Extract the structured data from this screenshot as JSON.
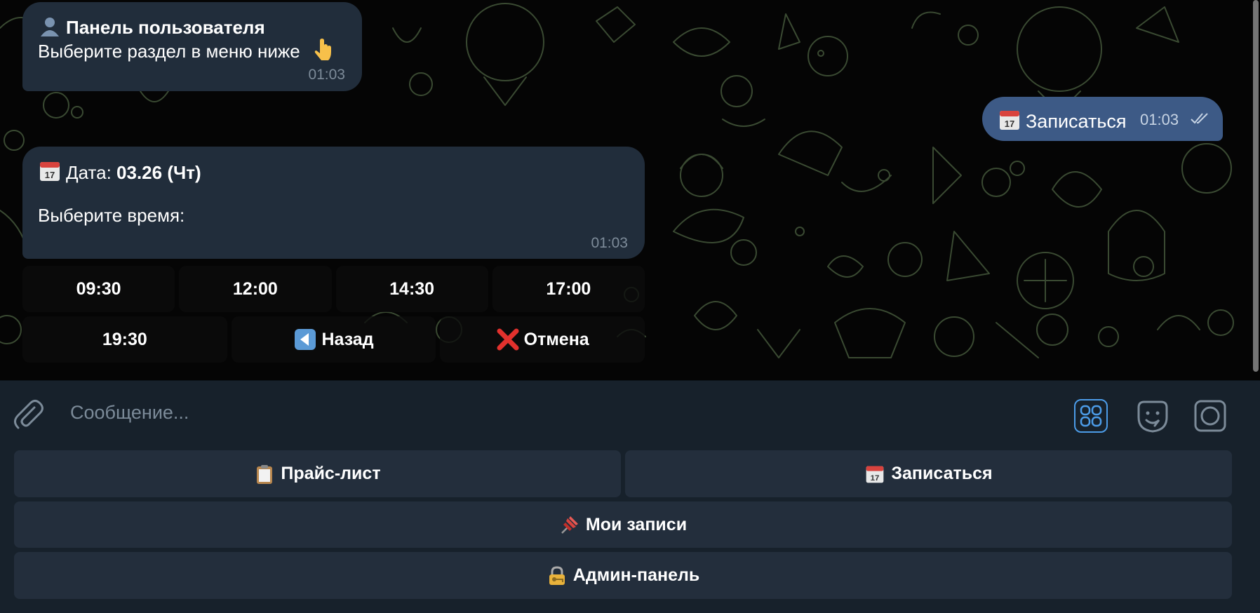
{
  "chat": {
    "messages": [
      {
        "title": "Панель пользователя",
        "text": "Выберите раздел в меню ниже",
        "time": "01:03",
        "title_icon": "user-silhouette-icon",
        "text_icon": "pointing-down-icon"
      },
      {
        "outgoing": true,
        "text": "Записаться",
        "time": "01:03",
        "icon": "calendar-icon",
        "status": "read"
      },
      {
        "date_label": "Дата:",
        "date_value": "03.26 (Чт)",
        "text": "Выберите время:",
        "time": "01:03",
        "icon": "calendar-icon"
      }
    ],
    "inline_keyboard": {
      "row1": [
        "09:30",
        "12:00",
        "14:30",
        "17:00"
      ],
      "row2": [
        {
          "label": "19:30"
        },
        {
          "label": "Назад",
          "icon": "back-arrow-icon"
        },
        {
          "label": "Отмена",
          "icon": "red-cross-icon"
        }
      ]
    }
  },
  "input": {
    "placeholder": "Сообщение..."
  },
  "reply_keyboard": {
    "buttons": [
      {
        "label": "Прайс-лист",
        "icon": "clipboard-icon"
      },
      {
        "label": "Записаться",
        "icon": "calendar-icon"
      },
      {
        "label": "Мои записи",
        "icon": "pushpin-icon"
      },
      {
        "label": "Админ-панель",
        "icon": "lock-with-key-icon"
      }
    ]
  },
  "colors": {
    "bubble_incoming": "#212d3b",
    "bubble_outgoing": "#3d5a86",
    "panel": "#17212b",
    "button": "#232e3c",
    "accent": "#4c9ce8"
  }
}
